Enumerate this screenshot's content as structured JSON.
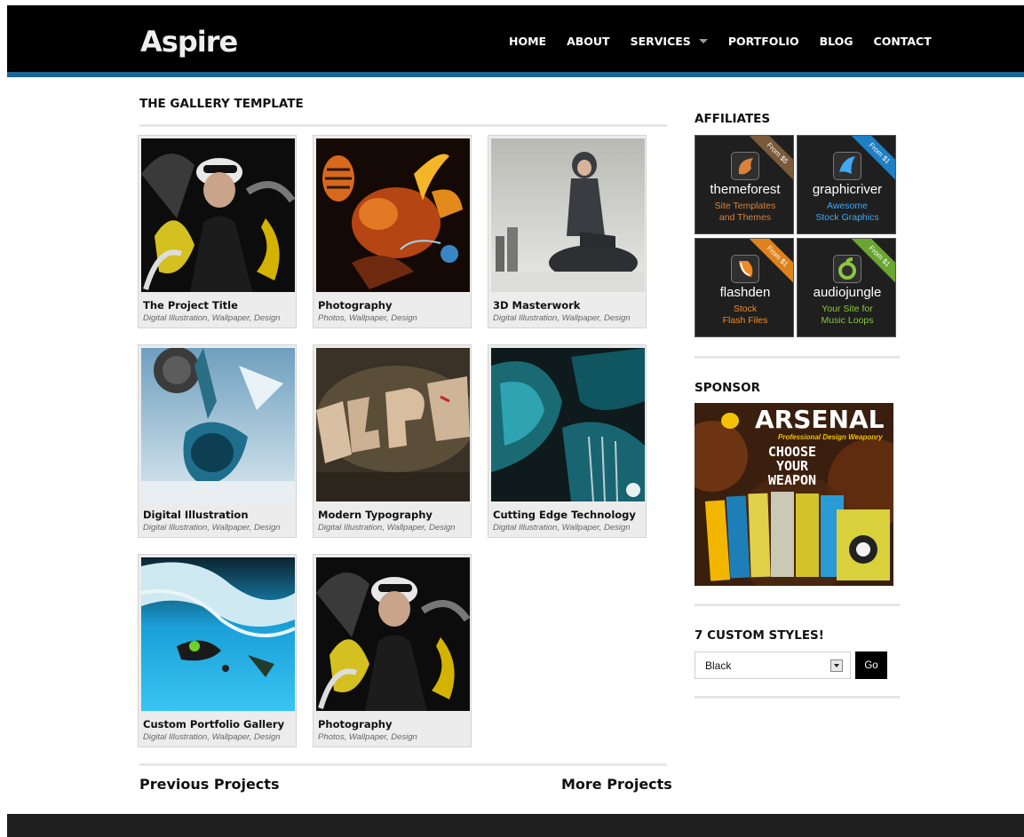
{
  "header": {
    "logo": "Aspire",
    "nav": [
      "HOME",
      "ABOUT",
      "SERVICES",
      "PORTFOLIO",
      "BLOG",
      "CONTACT"
    ]
  },
  "gallery": {
    "title": "THE GALLERY TEMPLATE",
    "items": [
      {
        "title": "The Project Title",
        "tags": "Digital Illustration, Wallpaper, Design"
      },
      {
        "title": "Photography",
        "tags": "Photos, Wallpaper, Design"
      },
      {
        "title": "3D Masterwork",
        "tags": "Digital Illustration, Wallpaper, Design"
      },
      {
        "title": "Digital Illustration",
        "tags": "Digital Illustration, Wallpaper, Design"
      },
      {
        "title": "Modern Typography",
        "tags": "Digital Illustration, Wallpaper, Design"
      },
      {
        "title": "Cutting Edge Technology",
        "tags": "Digital Illustration, Wallpaper, Design"
      },
      {
        "title": "Custom Portfolio Gallery",
        "tags": "Digital Illustration, Wallpaper, Design"
      },
      {
        "title": "Photography",
        "tags": "Photos, Wallpaper, Design"
      }
    ],
    "prev_label": "Previous Projects",
    "next_label": "More Projects"
  },
  "sidebar": {
    "affiliates_title": "AFFILIATES",
    "affiliates": [
      {
        "name": "themeforest",
        "line1": "Site Templates",
        "line2": "and Themes",
        "ribbon": "From $5",
        "accent": "#d9823b",
        "ribbon_color": "#7a5a3a",
        "icon": "leaf-icon"
      },
      {
        "name": "graphicriver",
        "line1": "Awesome",
        "line2": "Stock Graphics",
        "ribbon": "From $1",
        "accent": "#3fa9f5",
        "ribbon_color": "#1f7fc4",
        "icon": "fish-icon"
      },
      {
        "name": "flashden",
        "line1": "Stock",
        "line2": "Flash Files",
        "ribbon": "From $1",
        "accent": "#f08a24",
        "ribbon_color": "#e0821c",
        "icon": "flash-icon"
      },
      {
        "name": "audiojungle",
        "line1": "Your Site for",
        "line2": "Music Loops",
        "ribbon": "From $1",
        "accent": "#8cc63f",
        "ribbon_color": "#6aa531",
        "icon": "jungle-icon"
      }
    ],
    "sponsor_title": "SPONSOR",
    "sponsor": {
      "brand": "ARSENAL",
      "tagline": "Professional Design Weaponry",
      "cta": [
        "CHOOSE",
        "YOUR",
        "WEAPON"
      ]
    },
    "styles_title": "7 CUSTOM STYLES!",
    "style_select_value": "Black",
    "go_label": "Go"
  }
}
